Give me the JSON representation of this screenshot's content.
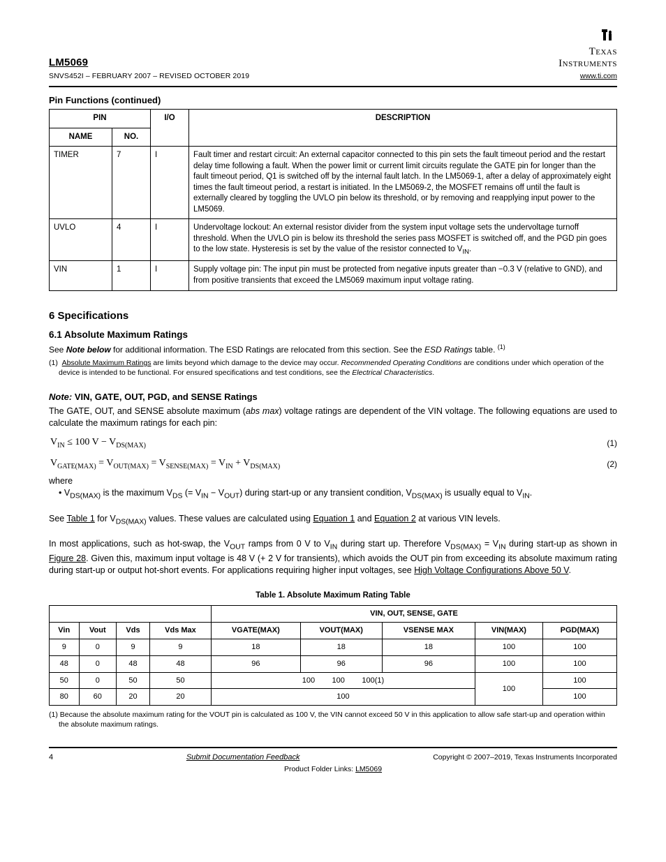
{
  "header": {
    "product": "LM5069",
    "docmeta": "SNVS452I – FEBRUARY 2007 – REVISED OCTOBER 2019",
    "url": "www.ti.com"
  },
  "table1": {
    "title": "Pin Functions (continued)",
    "headers": [
      "NAME",
      "NO.",
      "I/O",
      "DESCRIPTION"
    ],
    "rows": [
      {
        "name": "TIMER",
        "no": "7",
        "io": "I",
        "desc": "Fault timer and restart circuit: An external capacitor connected to this pin sets the fault timeout period and the restart delay time following a fault. When the power limit or current limit circuits regulate the GATE pin for longer than the fault timeout period, Q1 is switched off by the internal fault latch. In the LM5069-1, after a delay of approximately eight times the fault timeout period, a restart is initiated. In the LM5069-2, the MOSFET remains off until the fault is externally cleared by toggling the UVLO pin below its threshold, or by removing and reapplying input power to the LM5069.",
        "over": "UVLO"
      },
      {
        "name": "UVLO",
        "no": "4",
        "io": "I",
        "desc": "Undervoltage lockout: An external resistor divider from the system input voltage sets the undervoltage turnoff threshold. When the UVLO pin is below its threshold the series pass MOSFET is switched off, and the PGD pin goes to the low state. Hysteresis is set by the value of the resistor connected to V",
        "trail": "IN"
      },
      {
        "name": "VIN",
        "no": "1",
        "io": "I",
        "desc": "Supply voltage pin: The input pin must be protected from negative inputs greater than −0.3 V (relative to GND), and from positive transients that exceed the LM5069 maximum input voltage rating."
      }
    ]
  },
  "spec_title": "6   Specifications",
  "amr": {
    "heading": "6.1   Absolute Maximum Ratings",
    "intro1": "See ",
    "intro2a": "Note below",
    "intro2b": " for additional information. The ESD Ratings are relocated from this section. See the ",
    "intro2c": "ESD Ratings",
    "intro2d": " table.",
    "intro3a": "Absolute Maximum Ratings",
    "intro3b": " are limits beyond which damage to the device may occur.  ",
    "intro3c": "Recommended Operating Conditions",
    "intro3d": " are conditions under which operation of the device is intended to be functional. For ensured specifications and test conditions, see the ",
    "intro3e": "Electrical Characteristics",
    "intro3f": "."
  },
  "noteA_heading": "Note:",
  "noteA_body": " VIN, GATE, OUT, PGD, and SENSE Ratings",
  "noteA_p1a": "The GATE, OUT, and SENSE absolute maximum (",
  "noteA_p1b": "abs max",
  "noteA_p1c": ") voltage ratings are dependent of the VIN voltage. The following equations are used to calculate the maximum ratings for each pin:",
  "eq1_html": "V<sub>IN</sub> &le; 100 V &minus; V<sub>DS(MAX)</sub>",
  "eq2_html": "V<sub>GATE(MAX)</sub> = V<sub>OUT(MAX)</sub> = V<sub>SENSE(MAX)</sub> = V<sub>IN</sub> + V<sub>DS(MAX)</sub>",
  "eq1_no": "(1)",
  "eq2_no": "(2)",
  "where": {
    "lead": "where",
    "b1a": "•   V",
    "b1b": "DS(MAX)",
    "b1c": " is the maximum V",
    "b1d": "DS",
    "b1e": " (= V",
    "b1f": "IN",
    "b1g": " − V",
    "b1h": "OUT",
    "b1i": ") during start-up or any transient condition, V",
    "b1j": "DS(MAX)",
    "b1k": " is usually equal to V",
    "b1l": "IN",
    "b1m": "."
  },
  "p2a": "See ",
  "p2b": "Table 1",
  "p2c": " for V",
  "p2d": "DS(MAX)",
  "p2e": " values. These values are calculated using ",
  "p2f": "Equation 1",
  "p2g": " and ",
  "p2h": "Equation 2",
  "p2i": " at various VIN levels.",
  "p3a": "In most applications, such as hot-swap, the V",
  "p3b": "OUT",
  "p3c": " ramps from 0 V to V",
  "p3d": "IN",
  "p3e": " during start up. Therefore V",
  "p3f": "DS(MAX)",
  "p3g": " = V",
  "p3h": "IN",
  "p3i": " during start-up as shown in ",
  "p3j": "Figure 28",
  "p3k": ". Given this, maximum input voltage is 48 V (+ 2 V for transients), which avoids the OUT pin from exceeding its absolute maximum rating during start-up or output hot-short events. For applications requiring higher input voltages, see ",
  "p3l": "High Voltage Configurations Above 50 V",
  "p3m": ".",
  "table2": {
    "caption": "Table 1. Absolute Maximum Rating Table",
    "head_top_right": "VIN, OUT, SENSE, GATE",
    "head2": [
      "Vin",
      "Vout",
      "Vds",
      "Vds Max",
      "VGATE(MAX)",
      "VOUT(MAX)",
      "VSENSE MAX",
      "VIN(MAX)",
      "PGD(MAX)"
    ],
    "rows": [
      [
        "9",
        "0",
        "9",
        "9",
        "18",
        "18",
        "18",
        "100",
        "100"
      ],
      [
        "48",
        "0",
        "48",
        "48",
        "96",
        "96",
        "96",
        "100",
        "100"
      ],
      [
        "50",
        "0",
        "50",
        "50",
        "100",
        "100",
        "100(1)",
        "100",
        "100"
      ],
      [
        "80",
        "60",
        "20",
        "20",
        "100",
        "100"
      ]
    ],
    "footnote": "(1)   Because the absolute maximum rating for the VOUT pin is calculated as 100 V, the VIN cannot exceed 50 V in this application to allow safe start-up and operation within the absolute maximum ratings."
  },
  "footer": {
    "page": "4",
    "mid": "Submit Documentation Feedback",
    "copyright": "Copyright © 2007–2019, Texas Instruments Incorporated",
    "prodlinks_lead": "Product Folder Links: ",
    "prodlink": "LM5069"
  }
}
